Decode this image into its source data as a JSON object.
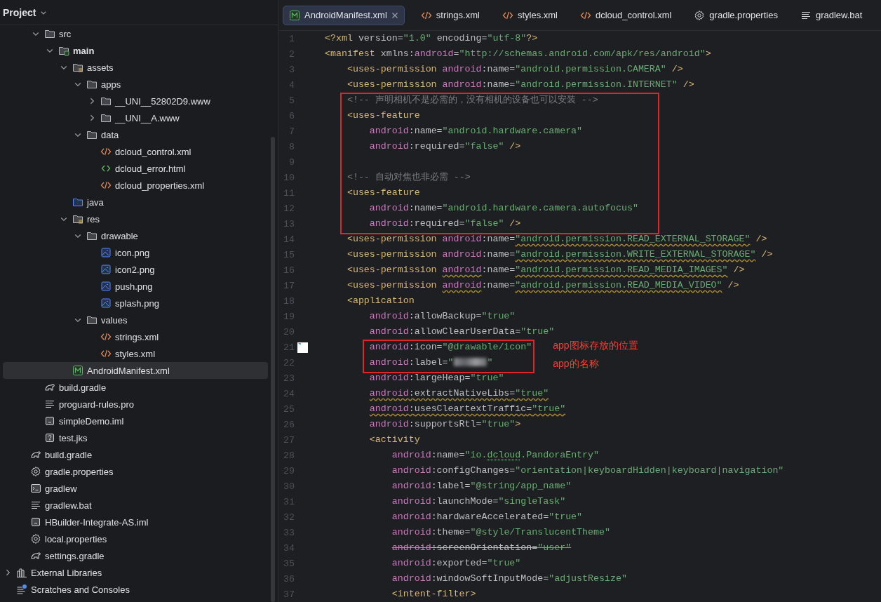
{
  "project_panel": {
    "title": "Project",
    "module_items": [
      {
        "label": "src",
        "kind": "folder",
        "expanded": true,
        "selected": false,
        "children": [
          {
            "label": "main",
            "kind": "module-folder",
            "expanded": true,
            "selected": false,
            "children": [
              {
                "label": "assets",
                "kind": "resource-folder",
                "expanded": true,
                "selected": false,
                "children": [
                  {
                    "label": "apps",
                    "kind": "folder",
                    "expanded": true,
                    "selected": false,
                    "children": [
                      {
                        "label": "__UNI__52802D9.www",
                        "kind": "folder",
                        "expanded": false,
                        "selected": false
                      },
                      {
                        "label": "__UNI__A.www",
                        "kind": "folder",
                        "expanded": false,
                        "selected": false
                      }
                    ]
                  },
                  {
                    "label": "data",
                    "kind": "folder",
                    "expanded": true,
                    "selected": false,
                    "children": [
                      {
                        "label": "dcloud_control.xml",
                        "kind": "xml",
                        "selected": false
                      },
                      {
                        "label": "dcloud_error.html",
                        "kind": "html",
                        "selected": false
                      },
                      {
                        "label": "dcloud_properties.xml",
                        "kind": "xml",
                        "selected": false
                      }
                    ]
                  }
                ]
              },
              {
                "label": "java",
                "kind": "source-folder",
                "selected": false
              },
              {
                "label": "res",
                "kind": "resource-folder",
                "expanded": true,
                "selected": false,
                "children": [
                  {
                    "label": "drawable",
                    "kind": "folder",
                    "expanded": true,
                    "selected": false,
                    "children": [
                      {
                        "label": "icon.png",
                        "kind": "image",
                        "selected": false
                      },
                      {
                        "label": "icon2.png",
                        "kind": "image",
                        "selected": false
                      },
                      {
                        "label": "push.png",
                        "kind": "image",
                        "selected": false
                      },
                      {
                        "label": "splash.png",
                        "kind": "image",
                        "selected": false
                      }
                    ]
                  },
                  {
                    "label": "values",
                    "kind": "folder",
                    "expanded": true,
                    "selected": false,
                    "children": [
                      {
                        "label": "strings.xml",
                        "kind": "xml",
                        "selected": false
                      },
                      {
                        "label": "styles.xml",
                        "kind": "xml",
                        "selected": false
                      }
                    ]
                  }
                ]
              },
              {
                "label": "AndroidManifest.xml",
                "kind": "manifest",
                "selected": true
              }
            ]
          }
        ]
      },
      {
        "label": "build.gradle",
        "kind": "gradle",
        "selected": false
      },
      {
        "label": "proguard-rules.pro",
        "kind": "text",
        "selected": false
      },
      {
        "label": "simpleDemo.iml",
        "kind": "iml",
        "selected": false
      },
      {
        "label": "test.jks",
        "kind": "unknown",
        "selected": false
      }
    ],
    "project_items": [
      {
        "label": "build.gradle",
        "kind": "gradle",
        "selected": false
      },
      {
        "label": "gradle.properties",
        "kind": "settings",
        "selected": false
      },
      {
        "label": "gradlew",
        "kind": "terminal",
        "selected": false
      },
      {
        "label": "gradlew.bat",
        "kind": "text",
        "selected": false
      },
      {
        "label": "HBuilder-Integrate-AS.iml",
        "kind": "iml",
        "selected": false
      },
      {
        "label": "local.properties",
        "kind": "settings",
        "selected": false
      },
      {
        "label": "settings.gradle",
        "kind": "gradle",
        "selected": false
      }
    ],
    "root_items": [
      {
        "label": "External Libraries",
        "kind": "libraries",
        "expanded": false,
        "selected": false
      },
      {
        "label": "Scratches and Consoles",
        "kind": "scratches",
        "selected": false
      }
    ]
  },
  "tabs": [
    {
      "label": "AndroidManifest.xml",
      "kind": "manifest",
      "selected": true
    },
    {
      "label": "strings.xml",
      "kind": "xml",
      "selected": false
    },
    {
      "label": "styles.xml",
      "kind": "xml",
      "selected": false
    },
    {
      "label": "dcloud_control.xml",
      "kind": "xml",
      "selected": false
    },
    {
      "label": "gradle.properties",
      "kind": "settings",
      "selected": false
    },
    {
      "label": "gradlew.bat",
      "kind": "text",
      "selected": false
    }
  ],
  "code": {
    "blocks": [
      {
        "framed": false,
        "lines": [
          {
            "number": "1",
            "preview": false,
            "tokens": [
              {
                "kind": "tag",
                "text": "<?xml"
              },
              {
                "kind": "attr",
                "text": " version"
              },
              {
                "kind": "op",
                "text": "="
              },
              {
                "kind": "str",
                "text": "\"1.0\""
              },
              {
                "kind": "attr",
                "text": " encoding"
              },
              {
                "kind": "op",
                "text": "="
              },
              {
                "kind": "str",
                "text": "\"utf-8\""
              },
              {
                "kind": "tag",
                "text": "?>"
              }
            ]
          },
          {
            "number": "2",
            "preview": false,
            "tokens": [
              {
                "kind": "tag",
                "text": "<manifest"
              },
              {
                "kind": "attr",
                "text": " xmlns"
              },
              {
                "kind": "op",
                "text": ":"
              },
              {
                "kind": "ns",
                "text": "android"
              },
              {
                "kind": "op",
                "text": "="
              },
              {
                "kind": "str",
                "text": "\"http://schemas.android.com/apk/res/android\""
              },
              {
                "kind": "tag",
                "text": ">"
              }
            ]
          },
          {
            "number": "3",
            "preview": false,
            "tokens": [
              {
                "kind": "tag",
                "text": "    <uses-permission"
              },
              {
                "kind": "ns",
                "text": " android"
              },
              {
                "kind": "op",
                "text": ":"
              },
              {
                "kind": "attr",
                "text": "name"
              },
              {
                "kind": "op",
                "text": "="
              },
              {
                "kind": "str",
                "text": "\"android.permission.CAMERA\""
              },
              {
                "kind": "tag",
                "text": " />"
              }
            ]
          },
          {
            "number": "4",
            "preview": false,
            "tokens": [
              {
                "kind": "tag",
                "text": "    <uses-permission"
              },
              {
                "kind": "ns",
                "text": " android"
              },
              {
                "kind": "op",
                "text": ":"
              },
              {
                "kind": "attr",
                "text": "name"
              },
              {
                "kind": "op",
                "text": "="
              },
              {
                "kind": "str",
                "text": "\"android.permission.INTERNET\""
              },
              {
                "kind": "tag",
                "text": " />"
              }
            ]
          }
        ]
      },
      {
        "framed": true,
        "lines": [
          {
            "number": "5",
            "preview": false,
            "tokens": [
              {
                "kind": "comment",
                "text": "    <!-- 声明相机不是必需的，没有相机的设备也可以安装 -->"
              }
            ]
          },
          {
            "number": "6",
            "preview": false,
            "tokens": [
              {
                "kind": "tag",
                "text": "    <uses-feature"
              }
            ]
          },
          {
            "number": "7",
            "preview": false,
            "tokens": [
              {
                "kind": "ns",
                "text": "        android"
              },
              {
                "kind": "op",
                "text": ":"
              },
              {
                "kind": "attr",
                "text": "name"
              },
              {
                "kind": "op",
                "text": "="
              },
              {
                "kind": "str",
                "text": "\"android.hardware.camera\""
              }
            ]
          },
          {
            "number": "8",
            "preview": false,
            "tokens": [
              {
                "kind": "ns",
                "text": "        android"
              },
              {
                "kind": "op",
                "text": ":"
              },
              {
                "kind": "attr",
                "text": "required"
              },
              {
                "kind": "op",
                "text": "="
              },
              {
                "kind": "str",
                "text": "\"false\""
              },
              {
                "kind": "tag",
                "text": " />"
              }
            ]
          },
          {
            "number": "9",
            "preview": false
          },
          {
            "number": "10",
            "preview": false,
            "tokens": [
              {
                "kind": "comment",
                "text": "    <!-- 自动对焦也非必需 -->"
              }
            ]
          },
          {
            "number": "11",
            "preview": false,
            "tokens": [
              {
                "kind": "tag",
                "text": "    <uses-feature"
              }
            ]
          },
          {
            "number": "12",
            "preview": false,
            "tokens": [
              {
                "kind": "ns",
                "text": "        android"
              },
              {
                "kind": "op",
                "text": ":"
              },
              {
                "kind": "attr",
                "text": "name"
              },
              {
                "kind": "op",
                "text": "="
              },
              {
                "kind": "str",
                "text": "\"android.hardware.camera.autofocus\""
              }
            ]
          },
          {
            "number": "13",
            "preview": false,
            "tokens": [
              {
                "kind": "ns",
                "text": "        android"
              },
              {
                "kind": "op",
                "text": ":"
              },
              {
                "kind": "attr",
                "text": "required"
              },
              {
                "kind": "op",
                "text": "="
              },
              {
                "kind": "str",
                "text": "\"false\""
              },
              {
                "kind": "tag",
                "text": " />"
              }
            ]
          }
        ]
      },
      {
        "framed": false,
        "lines": [
          {
            "number": "14",
            "preview": false,
            "tokens": [
              {
                "kind": "tag",
                "text": "    <uses-permission"
              },
              {
                "kind": "ns",
                "text": " android"
              },
              {
                "kind": "op",
                "text": ":"
              },
              {
                "kind": "attr",
                "text": "name"
              },
              {
                "kind": "op",
                "text": "="
              },
              {
                "kind": "str-warned",
                "text": "\"android.permission.READ_EXTERNAL_STORAGE\""
              },
              {
                "kind": "tag",
                "text": " />"
              }
            ]
          },
          {
            "number": "15",
            "preview": false,
            "tokens": [
              {
                "kind": "tag",
                "text": "    <uses-permission"
              },
              {
                "kind": "ns",
                "text": " android"
              },
              {
                "kind": "op",
                "text": ":"
              },
              {
                "kind": "attr",
                "text": "name"
              },
              {
                "kind": "op",
                "text": "="
              },
              {
                "kind": "str-warned",
                "text": "\"android.permission.WRITE_EXTERNAL_STORAGE\""
              },
              {
                "kind": "tag",
                "text": " />"
              }
            ]
          },
          {
            "number": "16",
            "preview": false,
            "tokens": [
              {
                "kind": "tag",
                "text": "    <uses-permission "
              },
              {
                "kind": "ns-warned",
                "text": "android"
              },
              {
                "kind": "op",
                "text": ":"
              },
              {
                "kind": "attr",
                "text": "name"
              },
              {
                "kind": "op",
                "text": "="
              },
              {
                "kind": "str-warned",
                "text": "\"android.permission.READ_MEDIA_IMAGES\""
              },
              {
                "kind": "tag",
                "text": " />"
              }
            ]
          },
          {
            "number": "17",
            "preview": false,
            "tokens": [
              {
                "kind": "tag",
                "text": "    <uses-permission "
              },
              {
                "kind": "ns-warned",
                "text": "android"
              },
              {
                "kind": "op",
                "text": ":"
              },
              {
                "kind": "attr",
                "text": "name"
              },
              {
                "kind": "op",
                "text": "="
              },
              {
                "kind": "str-warned",
                "text": "\"android.permission.READ_MEDIA_VIDEO\""
              },
              {
                "kind": "tag",
                "text": " />"
              }
            ]
          },
          {
            "number": "18",
            "preview": false,
            "tokens": [
              {
                "kind": "tag",
                "text": "    <application"
              }
            ]
          },
          {
            "number": "19",
            "preview": false,
            "tokens": [
              {
                "kind": "ns",
                "text": "        android"
              },
              {
                "kind": "op",
                "text": ":"
              },
              {
                "kind": "attr",
                "text": "allowBackup"
              },
              {
                "kind": "op",
                "text": "="
              },
              {
                "kind": "str",
                "text": "\"true\""
              }
            ]
          },
          {
            "number": "20",
            "preview": false,
            "tokens": [
              {
                "kind": "ns",
                "text": "        android"
              },
              {
                "kind": "op",
                "text": ":"
              },
              {
                "kind": "attr",
                "text": "allowClearUserData"
              },
              {
                "kind": "op",
                "text": "="
              },
              {
                "kind": "str",
                "text": "\"true\""
              }
            ]
          }
        ]
      },
      {
        "framed": true,
        "notes": [
          "app图标存放的位置",
          "app的名称"
        ],
        "lines": [
          {
            "number": "21",
            "preview": true,
            "tokens": [
              {
                "kind": "ns",
                "text": "        android"
              },
              {
                "kind": "op",
                "text": ":"
              },
              {
                "kind": "attr",
                "text": "icon"
              },
              {
                "kind": "op",
                "text": "="
              },
              {
                "kind": "str",
                "text": "\"@drawable/icon\""
              }
            ]
          },
          {
            "number": "22",
            "preview": false,
            "tokens": [
              {
                "kind": "ns",
                "text": "        android"
              },
              {
                "kind": "op",
                "text": ":"
              },
              {
                "kind": "attr",
                "text": "label"
              },
              {
                "kind": "op",
                "text": "="
              },
              {
                "kind": "str",
                "text": "\""
              },
              {
                "kind": "redacted"
              },
              {
                "kind": "str",
                "text": "\""
              }
            ]
          }
        ]
      },
      {
        "framed": false,
        "lines": [
          {
            "number": "23",
            "preview": false,
            "tokens": [
              {
                "kind": "ns",
                "text": "        android"
              },
              {
                "kind": "op",
                "text": ":"
              },
              {
                "kind": "attr",
                "text": "largeHeap"
              },
              {
                "kind": "op",
                "text": "="
              },
              {
                "kind": "str",
                "text": "\"true\""
              }
            ]
          },
          {
            "number": "24",
            "preview": false,
            "tokens": [
              {
                "kind": "ns-warned",
                "text": "        android"
              },
              {
                "kind": "op-warned",
                "text": ":"
              },
              {
                "kind": "attr-warned",
                "text": "extractNativeLibs"
              },
              {
                "kind": "op-warned",
                "text": "="
              },
              {
                "kind": "str-warned",
                "text": "\"true\""
              }
            ]
          },
          {
            "number": "25",
            "preview": false,
            "tokens": [
              {
                "kind": "ns-warned",
                "text": "        android"
              },
              {
                "kind": "op-warned",
                "text": ":"
              },
              {
                "kind": "attr-warned",
                "text": "usesCleartextTraffic"
              },
              {
                "kind": "op-warned",
                "text": "="
              },
              {
                "kind": "str-warned",
                "text": "\"true\""
              }
            ]
          },
          {
            "number": "26",
            "preview": false,
            "tokens": [
              {
                "kind": "ns",
                "text": "        android"
              },
              {
                "kind": "op",
                "text": ":"
              },
              {
                "kind": "attr",
                "text": "supportsRtl"
              },
              {
                "kind": "op",
                "text": "="
              },
              {
                "kind": "str",
                "text": "\"true\""
              },
              {
                "kind": "tag",
                "text": ">"
              }
            ]
          },
          {
            "number": "27",
            "preview": false,
            "tokens": [
              {
                "kind": "tag",
                "text": "        <activity"
              }
            ]
          },
          {
            "number": "28",
            "preview": false,
            "tokens": [
              {
                "kind": "ns",
                "text": "            android"
              },
              {
                "kind": "op",
                "text": ":"
              },
              {
                "kind": "attr",
                "text": "name"
              },
              {
                "kind": "op",
                "text": "="
              },
              {
                "kind": "str",
                "text": "\"io."
              },
              {
                "kind": "str-typo",
                "text": "dcloud"
              },
              {
                "kind": "str",
                "text": ".PandoraEntry\""
              }
            ]
          },
          {
            "number": "29",
            "preview": false,
            "tokens": [
              {
                "kind": "ns",
                "text": "            android"
              },
              {
                "kind": "op",
                "text": ":"
              },
              {
                "kind": "attr",
                "text": "configChanges"
              },
              {
                "kind": "op",
                "text": "="
              },
              {
                "kind": "str",
                "text": "\"orientation|keyboardHidden|keyboard|navigation\""
              }
            ]
          },
          {
            "number": "30",
            "preview": false,
            "tokens": [
              {
                "kind": "ns",
                "text": "            android"
              },
              {
                "kind": "op",
                "text": ":"
              },
              {
                "kind": "attr",
                "text": "label"
              },
              {
                "kind": "op",
                "text": "="
              },
              {
                "kind": "str",
                "text": "\"@string/app_name\""
              }
            ]
          },
          {
            "number": "31",
            "preview": false,
            "tokens": [
              {
                "kind": "ns",
                "text": "            android"
              },
              {
                "kind": "op",
                "text": ":"
              },
              {
                "kind": "attr",
                "text": "launchMode"
              },
              {
                "kind": "op",
                "text": "="
              },
              {
                "kind": "str",
                "text": "\"singleTask\""
              }
            ]
          },
          {
            "number": "32",
            "preview": false,
            "tokens": [
              {
                "kind": "ns",
                "text": "            android"
              },
              {
                "kind": "op",
                "text": ":"
              },
              {
                "kind": "attr",
                "text": "hardwareAccelerated"
              },
              {
                "kind": "op",
                "text": "="
              },
              {
                "kind": "str",
                "text": "\"true\""
              }
            ]
          },
          {
            "number": "33",
            "preview": false,
            "tokens": [
              {
                "kind": "ns",
                "text": "            android"
              },
              {
                "kind": "op",
                "text": ":"
              },
              {
                "kind": "attr",
                "text": "theme"
              },
              {
                "kind": "op",
                "text": "="
              },
              {
                "kind": "str",
                "text": "\"@style/TranslucentTheme\""
              }
            ]
          },
          {
            "number": "34",
            "preview": false,
            "tokens": [
              {
                "kind": "ns-deprecated",
                "text": "            android"
              },
              {
                "kind": "op-deprecated",
                "text": ":"
              },
              {
                "kind": "attr-deprecated",
                "text": "screenOrientation"
              },
              {
                "kind": "op-deprecated",
                "text": "="
              },
              {
                "kind": "str-deprecated",
                "text": "\"user\""
              }
            ]
          },
          {
            "number": "35",
            "preview": false,
            "tokens": [
              {
                "kind": "ns",
                "text": "            android"
              },
              {
                "kind": "op",
                "text": ":"
              },
              {
                "kind": "attr",
                "text": "exported"
              },
              {
                "kind": "op",
                "text": "="
              },
              {
                "kind": "str",
                "text": "\"true\""
              }
            ]
          },
          {
            "number": "36",
            "preview": false,
            "tokens": [
              {
                "kind": "ns",
                "text": "            android"
              },
              {
                "kind": "op",
                "text": ":"
              },
              {
                "kind": "attr",
                "text": "windowSoftInputMode"
              },
              {
                "kind": "op",
                "text": "="
              },
              {
                "kind": "str",
                "text": "\"adjustResize\""
              }
            ]
          },
          {
            "number": "37",
            "preview": false,
            "tokens": [
              {
                "kind": "tag",
                "text": "            <intent-filter>"
              }
            ]
          }
        ]
      }
    ]
  }
}
